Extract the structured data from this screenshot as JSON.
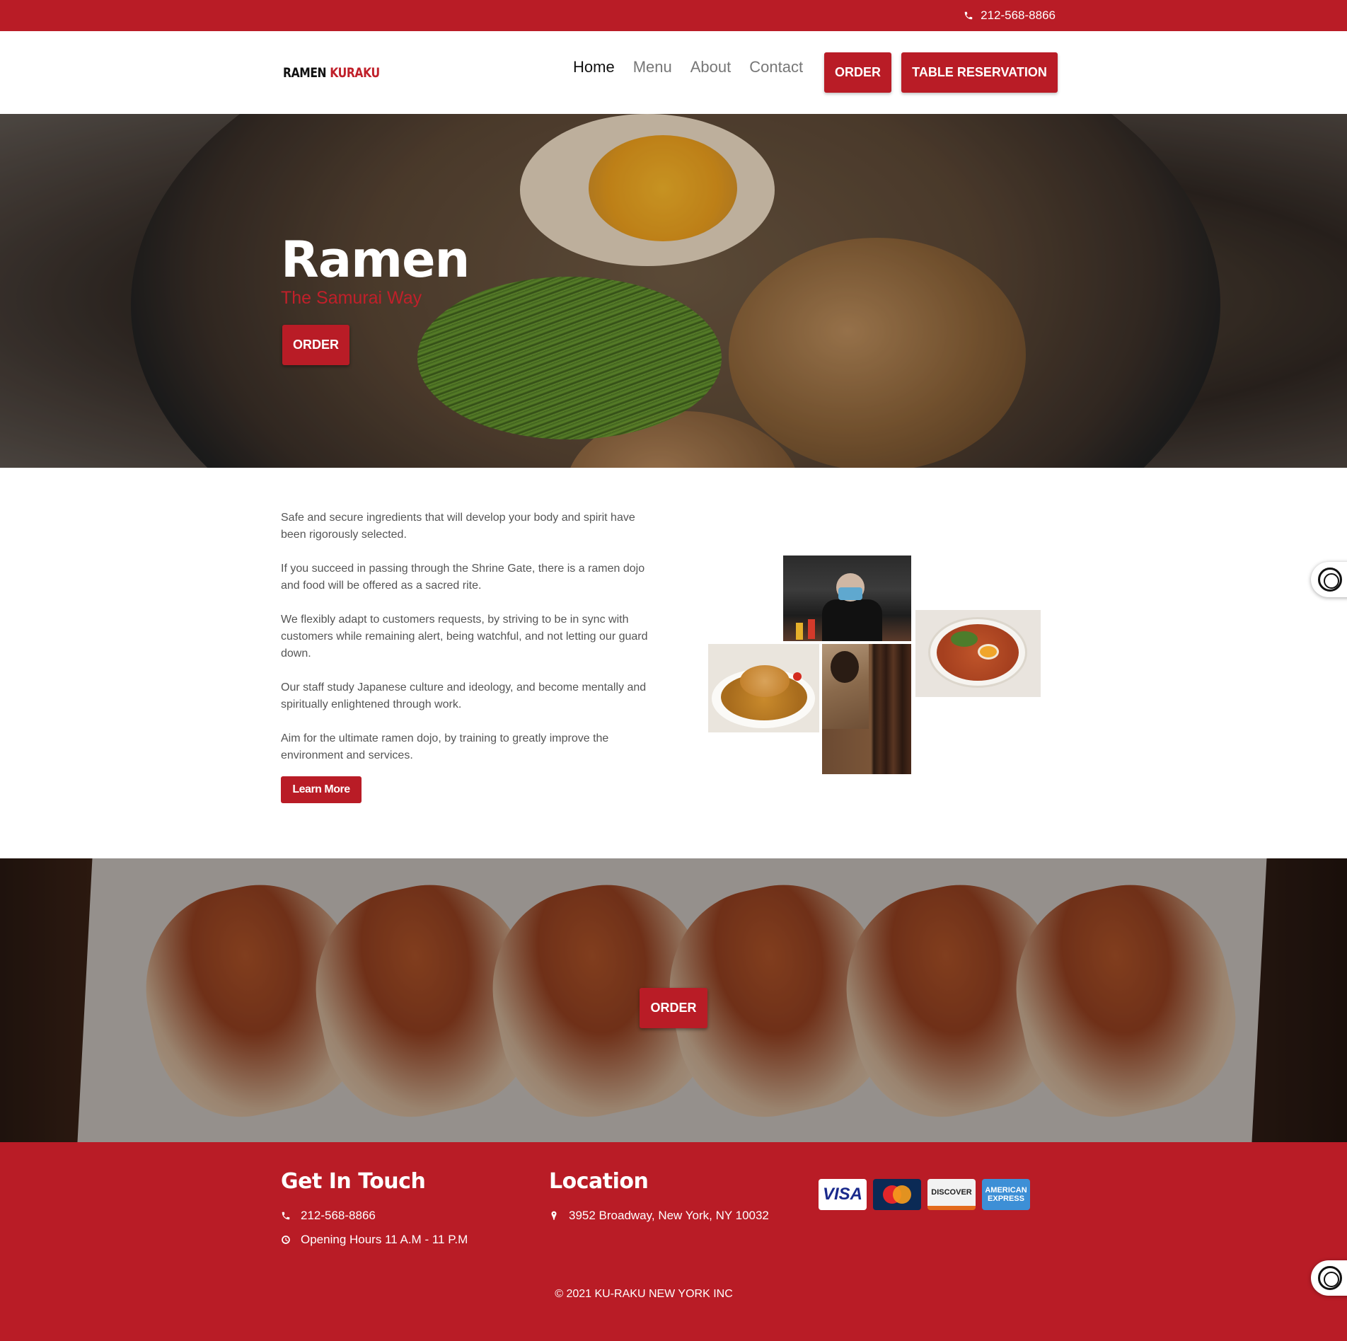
{
  "topbar": {
    "phone": "212-568-8866",
    "phone_icon": "phone-icon"
  },
  "header": {
    "logo": {
      "part1": "RAMEN",
      "part2": "KURAKU"
    },
    "nav": [
      {
        "label": "Home",
        "active": true
      },
      {
        "label": "Menu",
        "active": false
      },
      {
        "label": "About",
        "active": false
      },
      {
        "label": "Contact",
        "active": false
      }
    ],
    "order_label": "ORDER",
    "reservation_label": "TABLE RESERVATION"
  },
  "hero": {
    "title": "Ramen",
    "tagline": "The Samurai Way",
    "order_label": "ORDER"
  },
  "about": {
    "paragraphs": [
      "Safe and secure ingredients that will develop your body and spirit have been rigorously selected.",
      "If you succeed in passing through the Shrine Gate, there is a ramen dojo and food will be offered as a sacred rite.",
      "We flexibly adapt to customers requests, by striving to be in sync with customers while remaining alert, being watchful, and not letting our guard down.",
      "Our staff study Japanese culture and ideology, and become mentally and spiritually enlightened through work.",
      "Aim for the ultimate ramen dojo, by training to greatly improve the environment and services."
    ],
    "learn_more_label": "Learn More"
  },
  "banner": {
    "order_label": "ORDER"
  },
  "footer": {
    "get_in_touch": {
      "title": "Get In Touch",
      "phone": "212-568-8866",
      "hours": "Opening Hours 11 A.M - 11 P.M"
    },
    "location": {
      "title": "Location",
      "address": "3952 Broadway, New York, NY 10032"
    },
    "cards": {
      "visa": "VISA",
      "discover": "DISCOVER",
      "amex_line1": "AMERICAN",
      "amex_line2": "EXPRESS"
    },
    "copyright": "© 2021 KU-RAKU NEW YORK INC"
  },
  "colors": {
    "brand_red": "#b91c26",
    "text_gray": "#555555"
  }
}
